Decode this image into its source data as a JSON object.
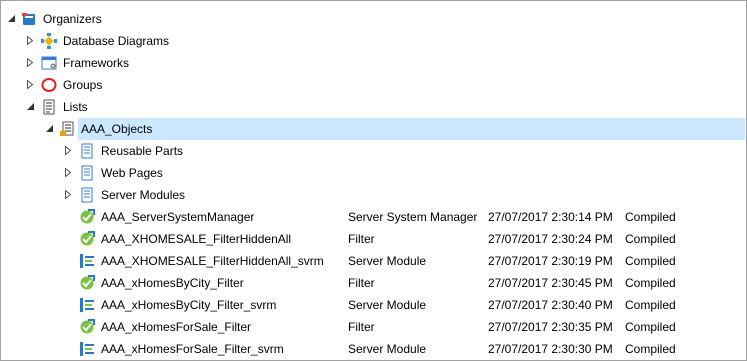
{
  "tree": {
    "rows": [
      {
        "label": "Organizers",
        "icon": "organizers-icon",
        "expanded": true
      },
      {
        "label": "Database Diagrams",
        "icon": "database-diagrams-icon",
        "expanded": false
      },
      {
        "label": "Frameworks",
        "icon": "frameworks-icon",
        "expanded": false
      },
      {
        "label": "Groups",
        "icon": "groups-icon",
        "expanded": false
      },
      {
        "label": "Lists",
        "icon": "lists-icon",
        "expanded": true
      },
      {
        "label": "AAA_Objects",
        "icon": "list-object-icon",
        "expanded": true,
        "selected": true
      },
      {
        "label": "Reusable Parts",
        "icon": "page-icon",
        "expanded": false
      },
      {
        "label": "Web Pages",
        "icon": "page-icon",
        "expanded": false
      },
      {
        "label": "Server Modules",
        "icon": "page-icon",
        "expanded": false
      },
      {
        "label": "AAA_ServerSystemManager",
        "icon": "filter-icon",
        "type": "Server System Manager",
        "date": "27/07/2017 2:30:14 PM",
        "status": "Compiled"
      },
      {
        "label": "AAA_XHOMESALE_FilterHiddenAll",
        "icon": "filter-icon",
        "type": "Filter",
        "date": "27/07/2017 2:30:24 PM",
        "status": "Compiled"
      },
      {
        "label": "AAA_XHOMESALE_FilterHiddenAll_svrm",
        "icon": "server-module-icon",
        "type": "Server Module",
        "date": "27/07/2017 2:30:19 PM",
        "status": "Compiled"
      },
      {
        "label": "AAA_xHomesByCity_Filter",
        "icon": "filter-icon",
        "type": "Filter",
        "date": "27/07/2017 2:30:45 PM",
        "status": "Compiled"
      },
      {
        "label": "AAA_xHomesByCity_Filter_svrm",
        "icon": "server-module-icon",
        "type": "Server Module",
        "date": "27/07/2017 2:30:40 PM",
        "status": "Compiled"
      },
      {
        "label": "AAA_xHomesForSale_Filter",
        "icon": "filter-icon",
        "type": "Filter",
        "date": "27/07/2017 2:30:35 PM",
        "status": "Compiled"
      },
      {
        "label": "AAA_xHomesForSale_Filter_svrm",
        "icon": "server-module-icon",
        "type": "Server Module",
        "date": "27/07/2017 2:30:30 PM",
        "status": "Compiled"
      }
    ]
  },
  "colors": {
    "selection": "#cce8ff",
    "border": "#a0a0a0"
  }
}
